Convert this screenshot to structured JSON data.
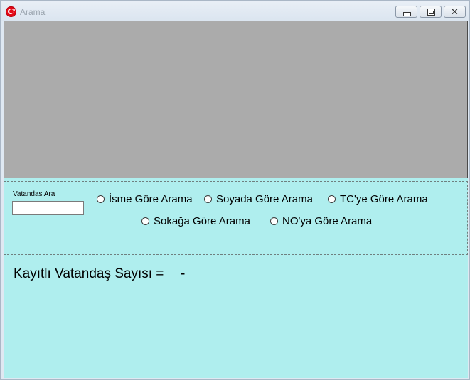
{
  "window": {
    "title": "Arama",
    "close_glyph": "✕"
  },
  "search": {
    "label": "Vatandas Ara :",
    "input_value": "",
    "options": [
      {
        "label": "İsme Göre Arama",
        "checked": false
      },
      {
        "label": "Soyada Göre Arama",
        "checked": false
      },
      {
        "label": "TC'ye Göre Arama",
        "checked": false
      },
      {
        "label": "Sokağa Göre Arama",
        "checked": false
      },
      {
        "label": "NO'ya Göre Arama",
        "checked": false
      }
    ]
  },
  "summary": {
    "count_label": "Kayıtlı Vatandaş Sayısı =",
    "count_value": "-"
  },
  "colors": {
    "client_background": "#afeeee",
    "grid_background": "#ababab",
    "flag_red": "#e30a17"
  }
}
